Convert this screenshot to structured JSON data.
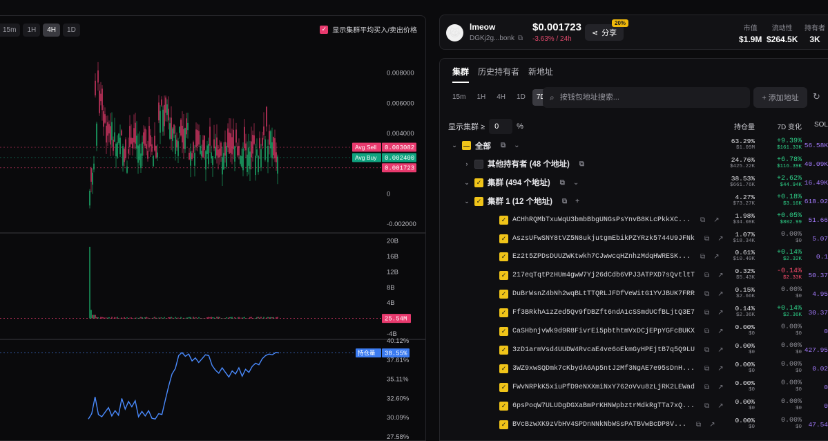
{
  "chart_toolbar": {
    "timeframes": [
      "15m",
      "1H",
      "4H",
      "1D"
    ],
    "active_timeframe": "4H",
    "avg_toggle_label": "显示集群平均买入/卖出价格",
    "avg_toggle_checked": true
  },
  "chart_data": [
    {
      "type": "candlestick",
      "y_ticks": [
        "0.008000",
        "0.006000",
        "0.004000",
        "0",
        "-0.002000"
      ],
      "ylim": [
        -0.0025,
        0.0105
      ],
      "markers": [
        {
          "name": "Avg Sell",
          "label": "0.003082",
          "value": 0.003082,
          "color": "#e83a6e"
        },
        {
          "name": "Avg Buy",
          "label": "0.002400",
          "value": 0.0024,
          "color": "#10a37f"
        },
        {
          "name": "",
          "label": "0.001723",
          "value": 0.001723,
          "color": "#e83a6e"
        }
      ]
    },
    {
      "type": "bar",
      "y_ticks": [
        "20B",
        "16B",
        "12B",
        "8B",
        "4B",
        "-4B"
      ],
      "ylim": [
        -4,
        21
      ],
      "current_label": "25.54M"
    },
    {
      "type": "line",
      "y_ticks": [
        "40.12%",
        "37.61%",
        "35.11%",
        "32.60%",
        "30.09%",
        "27.58%"
      ],
      "ylim": [
        27.3,
        40.5
      ],
      "current": {
        "name": "持仓量",
        "label": "38.55%",
        "value": 38.55
      },
      "series_values": [
        29.9,
        30.6,
        32.8,
        30.5,
        30.2,
        30.8,
        31.4,
        30.3,
        31.0,
        30.4,
        32.6,
        31.2,
        32.2,
        31.5,
        32.3,
        30.2,
        30.9,
        30.3,
        31.0,
        30.0,
        29.9,
        30.6,
        30.5,
        32.4,
        34.2,
        35.8,
        36.5,
        38.2,
        38.6,
        38.1,
        38.4,
        37.5,
        37.9,
        37.3,
        37.8,
        38.3,
        38.2,
        36.9,
        36.3,
        35.9,
        36.6,
        36.0,
        35.4,
        36.2,
        35.8,
        36.6,
        35.5,
        36.4,
        36.0,
        36.8,
        37.2,
        37.0,
        37.8,
        38.2,
        38.4,
        38.3,
        38.6,
        38.55
      ]
    }
  ],
  "token": {
    "name": "lmeow",
    "address": "DGKj2g...bonk",
    "price": "$0.001723",
    "change": "-3.63% / 24h",
    "share_label": "分享",
    "share_badge": "20%",
    "stats": [
      {
        "label": "市值",
        "value": "$1.9M"
      },
      {
        "label": "流动性",
        "value": "$264.5K"
      },
      {
        "label": "持有者",
        "value": "3K"
      }
    ]
  },
  "panel": {
    "tabs": [
      "集群",
      "历史持有者",
      "新地址"
    ],
    "active_tab": "集群",
    "timeframes": [
      "15m",
      "1H",
      "4H",
      "1D",
      "7D"
    ],
    "active_timeframe": "7D",
    "search_placeholder": "按钱包地址搜索...",
    "add_label": "+ 添加地址",
    "filter_label": "显示集群 ≥",
    "filter_value": "0",
    "filter_unit": "%",
    "col_holdings": "持仓量",
    "col_change": "7D 变化",
    "col_sol": "SOL"
  },
  "rows": [
    {
      "level": 0,
      "caret": "⌄",
      "cb": "dash",
      "label": "全部",
      "bold": true,
      "icons": [
        "⧉",
        "⌄"
      ],
      "pct": "63.29%",
      "usd": "$1.09M",
      "chg": "+9.39%",
      "chg_usd": "$161.33K",
      "dir": "pos",
      "sol": "56.58K"
    },
    {
      "level": 1,
      "caret": "›",
      "cb": "empty",
      "label": "其他持有者 (48 个地址)",
      "bold": true,
      "icons": [
        "⧉"
      ],
      "pct": "24.76%",
      "usd": "$425.22K",
      "chg": "+6.78%",
      "chg_usd": "$116.39K",
      "dir": "pos",
      "sol": "40.09K"
    },
    {
      "level": 1,
      "caret": "⌄",
      "cb": "yellow",
      "label": "集群 (494 个地址)",
      "bold": true,
      "icons": [
        "⧉",
        "⌄"
      ],
      "pct": "38.53%",
      "usd": "$661.76K",
      "chg": "+2.62%",
      "chg_usd": "$44.94K",
      "dir": "pos",
      "sol": "16.49K"
    },
    {
      "level": 2,
      "caret": "⌄",
      "cb": "yellow",
      "label": "集群 1 (12 个地址)",
      "bold": true,
      "icons": [
        "⧉",
        "+"
      ],
      "pct": "4.27%",
      "usd": "$73.27K",
      "chg": "+0.18%",
      "chg_usd": "$3.16K",
      "dir": "pos",
      "sol": "618.02"
    },
    {
      "level": 3,
      "cb": "yellow",
      "label": "ACHhRQMbTxuWqU3bmbBbgUNGsPsYnvB8KLcPkkXC...",
      "addr": true,
      "icons": [
        "⧉",
        "↗"
      ],
      "pct": "1.98%",
      "usd": "$34.08K",
      "chg": "+0.05%",
      "chg_usd": "$802.99",
      "dir": "pos",
      "sol": "51.66"
    },
    {
      "level": 3,
      "cb": "yellow",
      "label": "AszsUFwSNY8tVZ5N8ukjutgmEbikPZYRzk5744U9JFNk",
      "addr": true,
      "icons": [
        "⧉",
        "↗"
      ],
      "pct": "1.07%",
      "usd": "$18.34K",
      "chg": "0.00%",
      "chg_usd": "$0",
      "dir": "zero",
      "sol": "5.07"
    },
    {
      "level": 3,
      "cb": "yellow",
      "label": "Ez2t5ZPDsDUUZWKtwkh7CJwwcqHZnhzMdqHWRESK...",
      "addr": true,
      "icons": [
        "⧉",
        "↗"
      ],
      "pct": "0.61%",
      "usd": "$10.40K",
      "chg": "+0.14%",
      "chg_usd": "$2.32K",
      "dir": "pos",
      "sol": "0.1"
    },
    {
      "level": 3,
      "cb": "yellow",
      "label": "217eqTqtPzHUm4gwW7Yj26dCdb6VPJ3ATPXD7sQvtltT",
      "addr": true,
      "icons": [
        "⧉",
        "↗"
      ],
      "pct": "0.32%",
      "usd": "$5.43K",
      "chg": "-0.14%",
      "chg_usd": "$2.33K",
      "dir": "neg",
      "sol": "50.37"
    },
    {
      "level": 3,
      "cb": "yellow",
      "label": "DuBrWsnZ4bNh2wqBLtTTQRLJFDfVeWitG1YVJBUK7FRR",
      "addr": true,
      "icons": [
        "⧉",
        "↗"
      ],
      "pct": "0.15%",
      "usd": "$2.66K",
      "chg": "0.00%",
      "chg_usd": "$0",
      "dir": "zero",
      "sol": "4.95"
    },
    {
      "level": 3,
      "cb": "yellow",
      "label": "Ff3BRkhA1zZed5Qv9fDBZft6ndA1cSSmdUCfBLjtQ3E7",
      "addr": true,
      "icons": [
        "⧉",
        "↗"
      ],
      "pct": "0.14%",
      "usd": "$2.36K",
      "chg": "+0.14%",
      "chg_usd": "$2.36K",
      "dir": "pos",
      "sol": "30.37"
    },
    {
      "level": 3,
      "cb": "yellow",
      "label": "CaSHbnjvWk9d9R8FivrEi5pbthtmVxDCjEPpYGFcBUKX",
      "addr": true,
      "icons": [
        "⧉",
        "↗"
      ],
      "pct": "0.00%",
      "usd": "$0",
      "chg": "0.00%",
      "chg_usd": "$0",
      "dir": "zero",
      "sol": "0"
    },
    {
      "level": 3,
      "cb": "yellow",
      "label": "3zD1armVsd4UUDW4RvcaE4ve6oEkmGyHPEjtB7q5Q9LU",
      "addr": true,
      "icons": [
        "⧉",
        "↗"
      ],
      "pct": "0.00%",
      "usd": "$0",
      "chg": "0.00%",
      "chg_usd": "$0",
      "dir": "zero",
      "sol": "427.95"
    },
    {
      "level": 3,
      "cb": "yellow",
      "label": "3WZ9xwSQDmk7cKbydA6Ap5ntJ2Mf3NgAE7e95sDnH...",
      "addr": true,
      "icons": [
        "⧉",
        "↗"
      ],
      "pct": "0.00%",
      "usd": "$0",
      "chg": "0.00%",
      "chg_usd": "$0",
      "dir": "zero",
      "sol": "0.02"
    },
    {
      "level": 3,
      "cb": "yellow",
      "label": "FWvNRPkK5xiuPfD9eNXXmiNxY762oVvu8zLjRK2LEWad",
      "addr": true,
      "icons": [
        "⧉",
        "↗"
      ],
      "pct": "0.00%",
      "usd": "$0",
      "chg": "0.00%",
      "chg_usd": "$0",
      "dir": "zero",
      "sol": "0"
    },
    {
      "level": 3,
      "cb": "yellow",
      "label": "6psPoqW7ULUDgDGXaBmPrKHNWpbztrMdkRgTTa7xQ...",
      "addr": true,
      "icons": [
        "⧉",
        "↗"
      ],
      "pct": "0.00%",
      "usd": "$0",
      "chg": "0.00%",
      "chg_usd": "$0",
      "dir": "zero",
      "sol": "0"
    },
    {
      "level": 3,
      "cb": "yellow",
      "label": "BVcBzwXK9zVbHV4SPDnNNkNbWSsPATBVwBcDP8V...",
      "addr": true,
      "icons": [
        "⧉",
        "↗"
      ],
      "pct": "0.00%",
      "usd": "$0",
      "chg": "0.00%",
      "chg_usd": "$0",
      "dir": "zero",
      "sol": "47.54"
    }
  ]
}
